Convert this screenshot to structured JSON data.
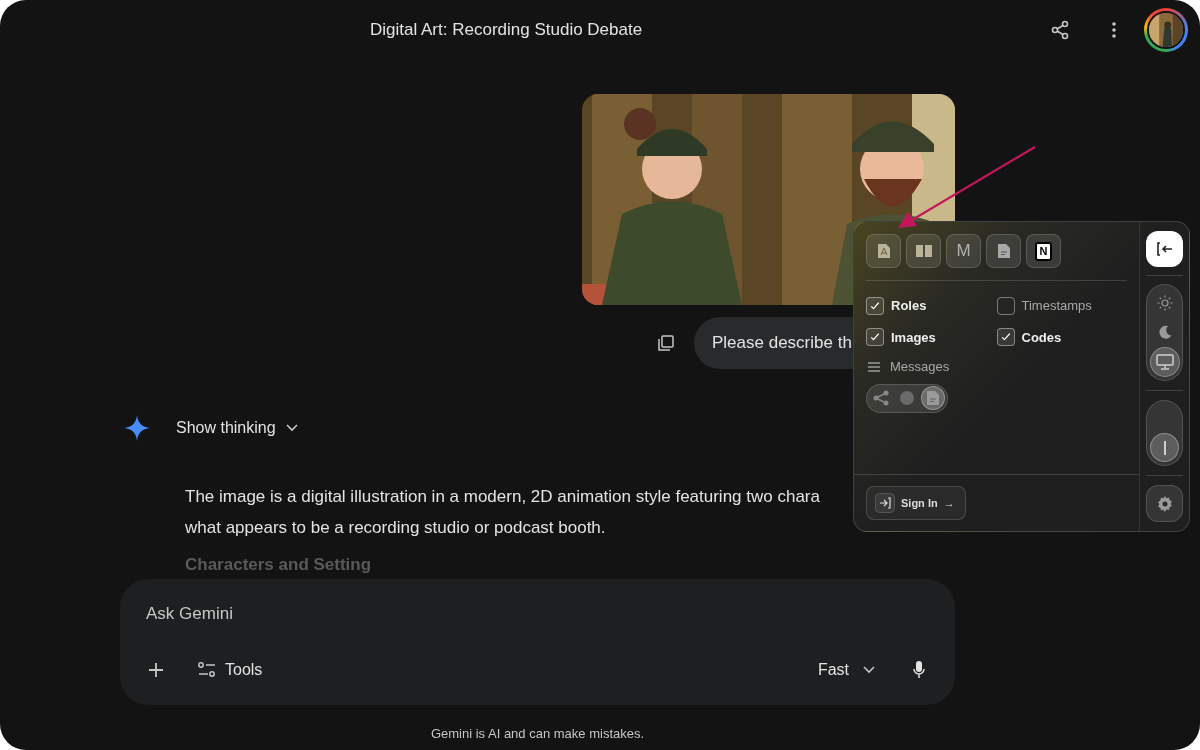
{
  "header": {
    "title": "Digital Art: Recording Studio Debate"
  },
  "user_message": {
    "text": "Please describe th"
  },
  "response": {
    "toggle_label": "Show thinking",
    "expanded": false,
    "lines": [
      "The image is a digital illustration in a modern, 2D animation style featuring two chara",
      "what appears to be a recording studio or podcast booth."
    ],
    "heading": "Characters and Setting"
  },
  "composer": {
    "placeholder": "Ask Gemini",
    "tools_label": "Tools",
    "mode": "Fast"
  },
  "disclaimer": "Gemini is AI and can make mistakes.",
  "export_panel": {
    "formats": [
      {
        "kind": "pdf"
      },
      {
        "kind": "reader"
      },
      {
        "kind": "letter",
        "label": "M"
      },
      {
        "kind": "doc"
      },
      {
        "kind": "badge",
        "label": "N"
      }
    ],
    "options": [
      {
        "label": "Roles",
        "checked": true
      },
      {
        "label": "Timestamps",
        "checked": false
      },
      {
        "label": "Images",
        "checked": true
      },
      {
        "label": "Codes",
        "checked": true
      }
    ],
    "messages_label": "Messages",
    "message_styles": [
      {
        "kind": "tree",
        "selected": false
      },
      {
        "kind": "dot",
        "selected": false
      },
      {
        "kind": "doc",
        "selected": true
      }
    ],
    "sign_in": {
      "label": "Sign In",
      "arrow": "→"
    },
    "themes": [
      {
        "kind": "light",
        "selected": false
      },
      {
        "kind": "dark",
        "selected": false
      },
      {
        "kind": "system",
        "selected": true
      }
    ],
    "toggle": {
      "on": false
    }
  }
}
